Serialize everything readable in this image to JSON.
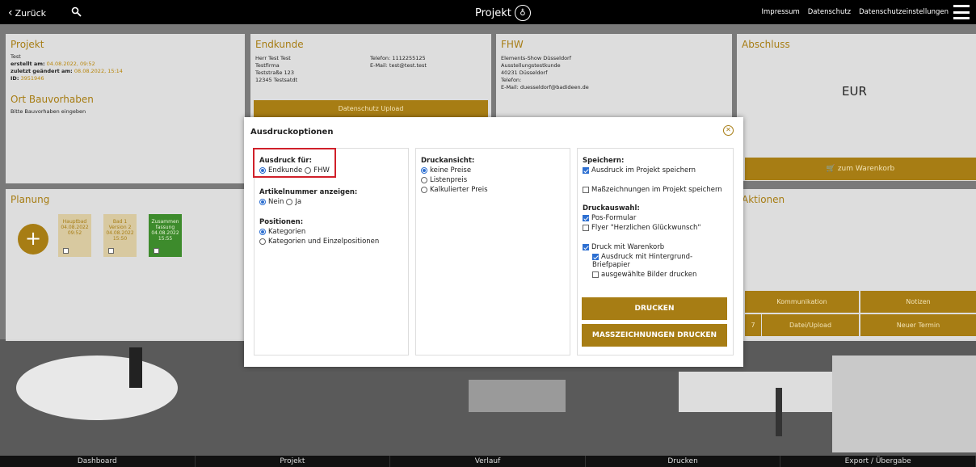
{
  "topbar": {
    "back_label": "Zurück",
    "title": "Projekt",
    "links": [
      "Impressum",
      "Datenschutz",
      "Datenschutzeinstellungen"
    ]
  },
  "projekt": {
    "heading": "Projekt",
    "name": "Test",
    "created_label": "erstellt am:",
    "created_value": "04.08.2022, 09:52",
    "changed_label": "zuletzt geändert am:",
    "changed_value": "08.08.2022, 15:14",
    "id_label": "ID:",
    "id_value": "3951946",
    "ort_heading": "Ort Bauvorhaben",
    "ort_text": "Bitte Bauvorhaben eingeben"
  },
  "endkunde": {
    "heading": "Endkunde",
    "lines": [
      "Herr Test Test",
      "Testfirma",
      "Teststraße 123",
      "12345 Testsatdt"
    ],
    "phone": "Telefon: 1112255125",
    "email": "E-Mail: test@test.test",
    "upload_button": "Datenschutz Upload"
  },
  "fhw": {
    "heading": "FHW",
    "lines": [
      "Elements-Show Düsseldorf",
      "Ausstellungstestkunde",
      "40231 Düsseldorf",
      "Telefon:",
      "E-Mail: duesseldorf@badideen.de"
    ]
  },
  "abschluss": {
    "heading": "Abschluss",
    "currency": "EUR",
    "cart_button": "zum Warenkorb",
    "aktionen_heading": "Aktionen",
    "buttons": {
      "kommunikation": "Kommunikation",
      "notizen": "Notizen",
      "count": "7",
      "datei": "Datei/Upload",
      "termin": "Neuer Termin"
    }
  },
  "planung": {
    "heading": "Planung",
    "tiles": [
      {
        "title": "Hauptbad",
        "date": "04.08.2022",
        "time": "09:52"
      },
      {
        "title": "Bad 1 Version 2",
        "date": "04.08.2022",
        "time": "15:50"
      },
      {
        "title": "Zusammen fassung",
        "date": "04.08.2022",
        "time": "15:55"
      }
    ]
  },
  "modal": {
    "title": "Ausdruckoptionen",
    "col1": {
      "ausdruck_label": "Ausdruck für:",
      "ausdruck_options": [
        "Endkunde",
        "FHW"
      ],
      "artikel_label": "Artikelnummer anzeigen:",
      "artikel_options": [
        "Nein",
        "Ja"
      ],
      "positionen_label": "Positionen:",
      "positionen_options": [
        "Kategorien",
        "Kategorien und Einzelpositionen"
      ]
    },
    "col2": {
      "label": "Druckansicht:",
      "options": [
        "keine Preise",
        "Listenpreis",
        "Kalkulierter Preis"
      ]
    },
    "col3": {
      "speichern_label": "Speichern:",
      "save_project": "Ausdruck im Projekt speichern",
      "save_mass": "Maßzeichnungen im Projekt speichern",
      "druckauswahl_label": "Druckauswahl:",
      "pos_formular": "Pos-Formular",
      "flyer": "Flyer \"Herzlichen Glückwunsch\"",
      "druck_warenkorb": "Druck mit Warenkorb",
      "hintergrund": "Ausdruck mit Hintergrund-",
      "hintergrund2": "Briefpapier",
      "bilder": "ausgewählte Bilder drucken",
      "print_button": "DRUCKEN",
      "mass_button": "MASSZEICHNUNGEN DRUCKEN"
    }
  },
  "bottomnav": [
    "Dashboard",
    "Projekt",
    "Verlauf",
    "Drucken",
    "Export / Übergabe"
  ]
}
